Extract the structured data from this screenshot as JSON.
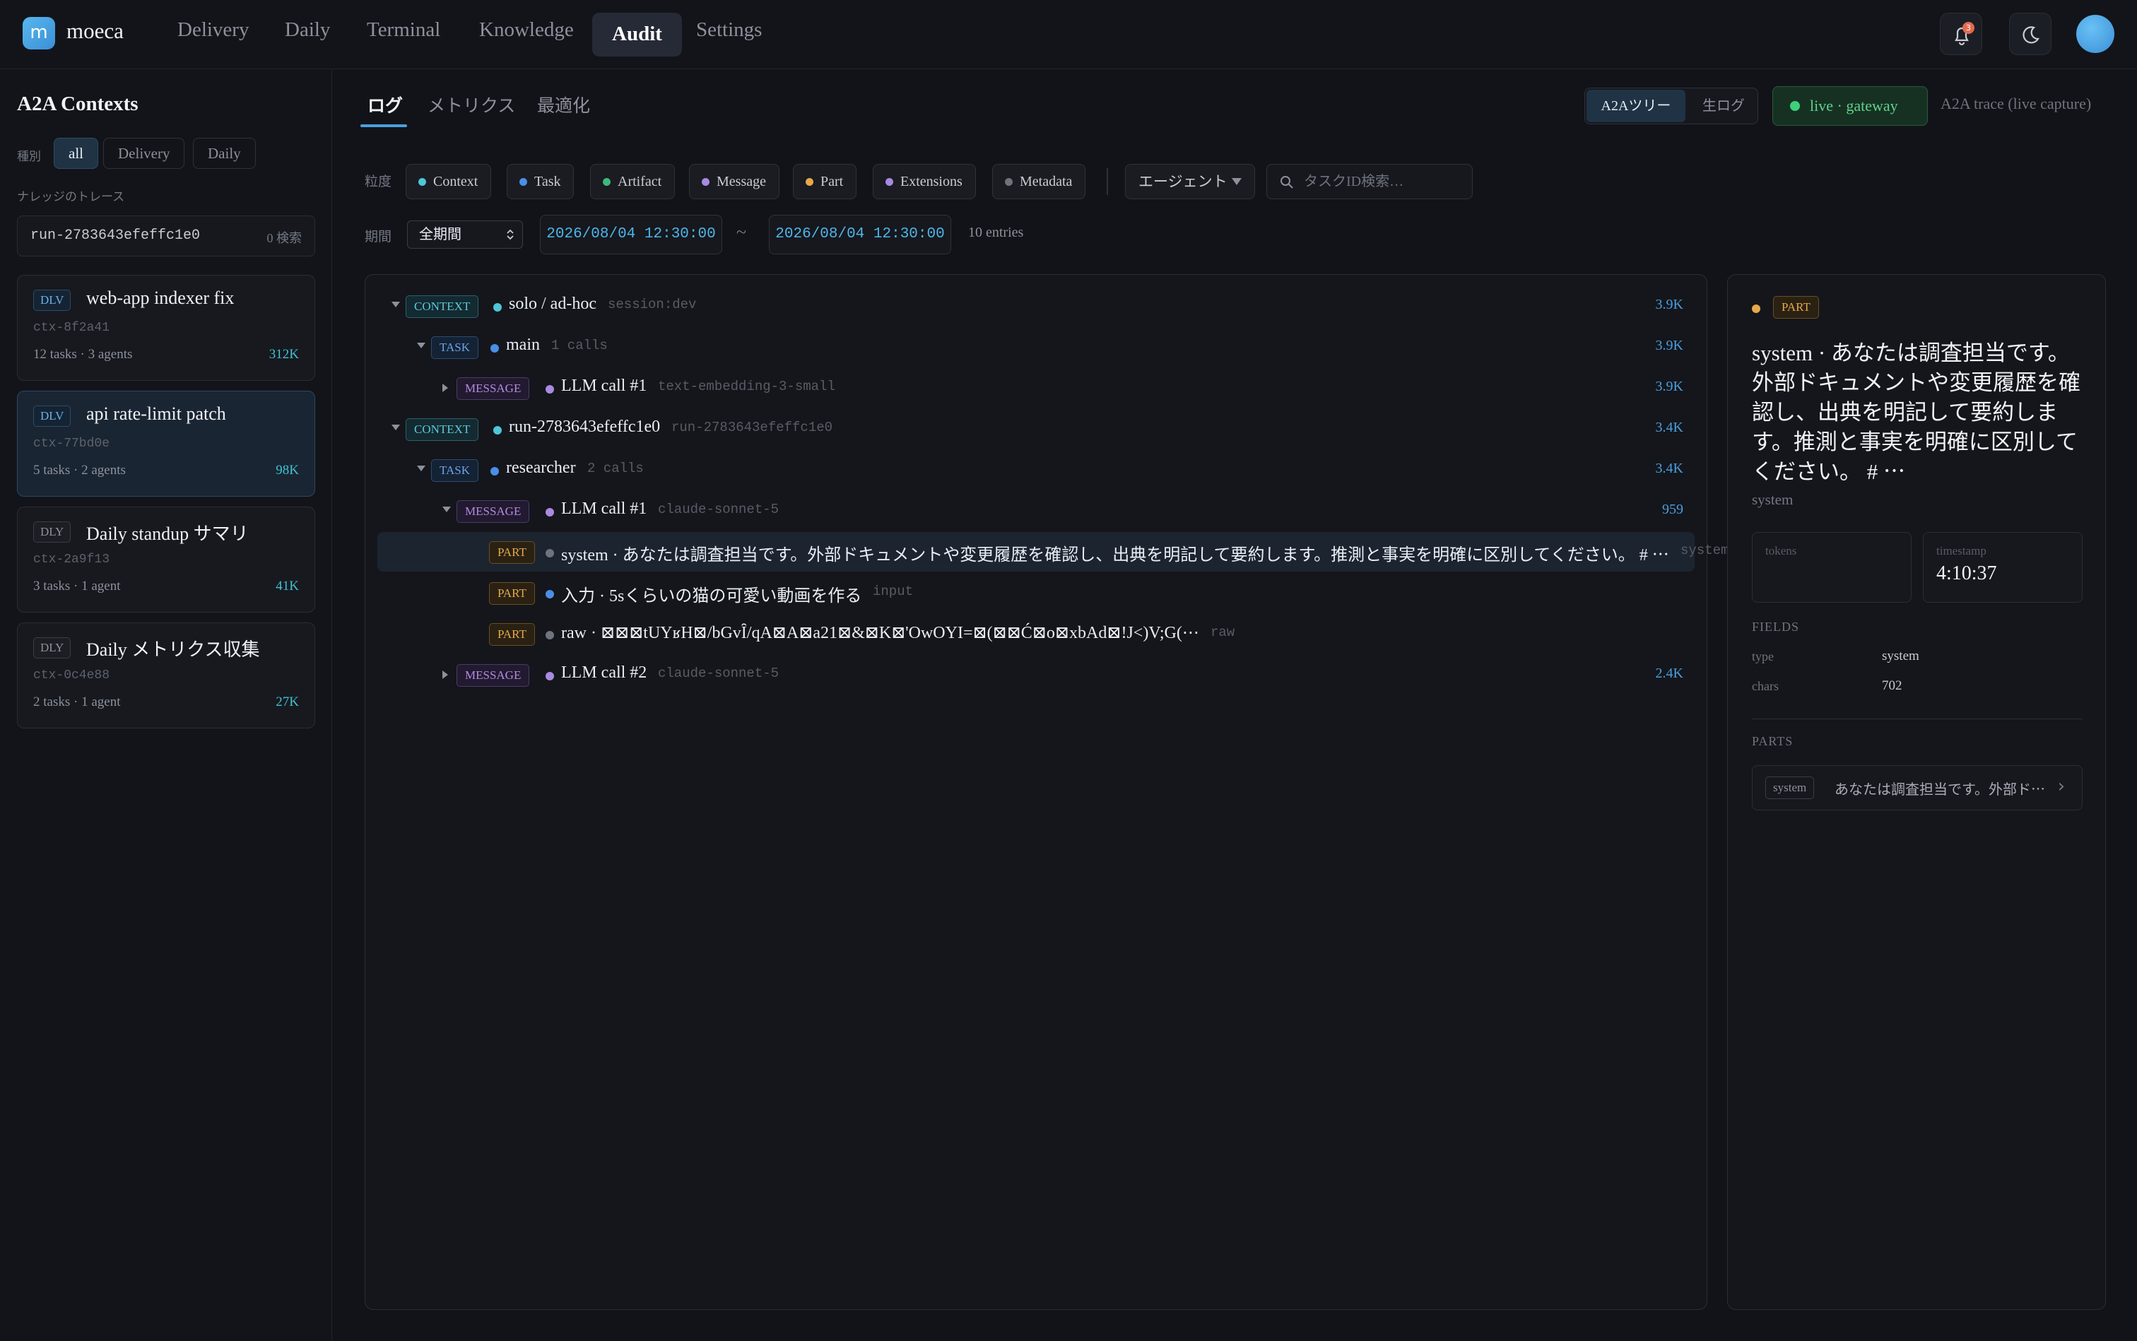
{
  "app": {
    "logo_letter": "m",
    "name": "moeca"
  },
  "nav": {
    "items": [
      "Delivery",
      "Daily",
      "Terminal",
      "Knowledge",
      "Audit",
      "Settings"
    ],
    "active": "Audit"
  },
  "header_icons": {
    "notifications": "bell-icon",
    "notif_count": "3",
    "theme": "moon-icon",
    "avatar": "avatar"
  },
  "sidebar": {
    "title": "A2A Contexts",
    "kind_label": "種別",
    "filters": [
      "all",
      "Delivery",
      "Daily"
    ],
    "active_filter": "all",
    "trace_label": "ナレッジのトレース",
    "trace_value": "run-2783643efeffc1e0",
    "trace_count": "0 検索",
    "contexts": [
      {
        "tag": "DLV",
        "title": "web-app indexer fix",
        "id": "ctx-8f2a41",
        "meta": "12 tasks · 3 agents",
        "count": "312K"
      },
      {
        "tag": "DLV",
        "title": "api rate-limit patch",
        "id": "ctx-77bd0e",
        "meta": "5 tasks · 2 agents",
        "count": "98K",
        "selected": true
      },
      {
        "tag": "DLY",
        "title": "Daily standup サマリ",
        "id": "ctx-2a9f13",
        "meta": "3 tasks · 1 agent",
        "count": "41K"
      },
      {
        "tag": "DLY",
        "title": "Daily メトリクス収集",
        "id": "ctx-0c4e88",
        "meta": "2 tasks · 1 agent",
        "count": "27K"
      }
    ]
  },
  "main": {
    "tabs": [
      "ログ",
      "メトリクス",
      "最適化"
    ],
    "active_tab": "ログ",
    "view_toggle": [
      "A2Aツリー",
      "生ログ"
    ],
    "live_badge": "live · gateway",
    "trace_label": "A2A trace (live capture)",
    "granularity_label": "粒度",
    "granularity": [
      {
        "label": "Context",
        "color": "#4fc6d8"
      },
      {
        "label": "Task",
        "color": "#4a8fe6"
      },
      {
        "label": "Artifact",
        "color": "#3fb87a"
      },
      {
        "label": "Message",
        "color": "#a98ae0"
      },
      {
        "label": "Part",
        "color": "#e6a94a"
      },
      {
        "label": "Extensions",
        "color": "#a98ae0"
      },
      {
        "label": "Metadata",
        "color": "#6e737e"
      }
    ],
    "agent_select": "エージェント",
    "search_placeholder": "タスクID検索…",
    "period_label": "期間",
    "period_value": "全期間",
    "date_from": "2026/08/04 12:30:00",
    "date_sep": "~",
    "date_to": "2026/08/04 12:30:00",
    "entries": "10 entries"
  },
  "tree": [
    {
      "depth": 0,
      "caret": "down",
      "tag": "CONTEXT",
      "kind": "ctx",
      "dot": "#4fc6d8",
      "label": "solo / ad-hoc",
      "sub": "session:dev",
      "num": "3.9K"
    },
    {
      "depth": 1,
      "caret": "down",
      "tag": "TASK",
      "kind": "task",
      "dot": "#4a8fe6",
      "label": "main",
      "sub": "1 calls",
      "num": "3.9K"
    },
    {
      "depth": 2,
      "caret": "right",
      "tag": "MESSAGE",
      "kind": "msg",
      "dot": "#a98ae0",
      "label": "LLM call #1",
      "sub": "text-embedding-3-small",
      "num": "3.9K"
    },
    {
      "depth": 0,
      "caret": "down",
      "tag": "CONTEXT",
      "kind": "ctx",
      "dot": "#4fc6d8",
      "label": "run-2783643efeffc1e0",
      "sub": "run-2783643efeffc1e0",
      "num": "3.4K"
    },
    {
      "depth": 1,
      "caret": "down",
      "tag": "TASK",
      "kind": "task",
      "dot": "#4a8fe6",
      "label": "researcher",
      "sub": "2 calls",
      "num": "3.4K"
    },
    {
      "depth": 2,
      "caret": "down",
      "tag": "MESSAGE",
      "kind": "msg",
      "dot": "#a98ae0",
      "label": "LLM call #1",
      "sub": "claude-sonnet-5",
      "num": "959"
    },
    {
      "depth": 3,
      "caret": "",
      "tag": "PART",
      "kind": "part",
      "dot": "#6e737e",
      "label": "system · あなたは調査担当です。外部ドキュメントや変更履歴を確認し、出典を明記して要約します。推測と事実を明確に区別してください。 # ⋯",
      "sub": "system",
      "num": "",
      "highlight": true
    },
    {
      "depth": 3,
      "caret": "",
      "tag": "PART",
      "kind": "part",
      "dot": "#4a8fe6",
      "label": "入力 · 5sくらいの猫の可愛い動画を作る",
      "sub": "input",
      "num": ""
    },
    {
      "depth": 3,
      "caret": "",
      "tag": "PART",
      "kind": "part",
      "dot": "#6e737e",
      "label": "raw · ⊠⊠⊠tUYʁH⊠/bGvȊ/qA⊠A⊠a21⊠&⊠K⊠'OwOYI=⊠(⊠⊠Ć⊠o⊠xbAd⊠!J<)V;G(⋯",
      "sub": "raw",
      "num": ""
    },
    {
      "depth": 2,
      "caret": "right",
      "tag": "MESSAGE",
      "kind": "msg",
      "dot": "#a98ae0",
      "label": "LLM call #2",
      "sub": "claude-sonnet-5",
      "num": "2.4K"
    }
  ],
  "detail": {
    "tag": "PART",
    "title": "system · あなたは調査担当です。外部ドキュメントや変更履歴を確認し、出典を明記して要約します。推測と事実を明確に区別してください。 # ⋯",
    "subtitle": "system",
    "tokens_label": "tokens",
    "tokens_value": "",
    "timestamp_label": "timestamp",
    "timestamp_value": "4:10:37",
    "fields_header": "FIELDS",
    "fields": [
      {
        "key": "type",
        "value": "system"
      },
      {
        "key": "chars",
        "value": "702"
      }
    ],
    "parts_header": "PARTS",
    "parts": [
      {
        "tag": "system",
        "text": "あなたは調査担当です。外部ド⋯"
      }
    ]
  }
}
